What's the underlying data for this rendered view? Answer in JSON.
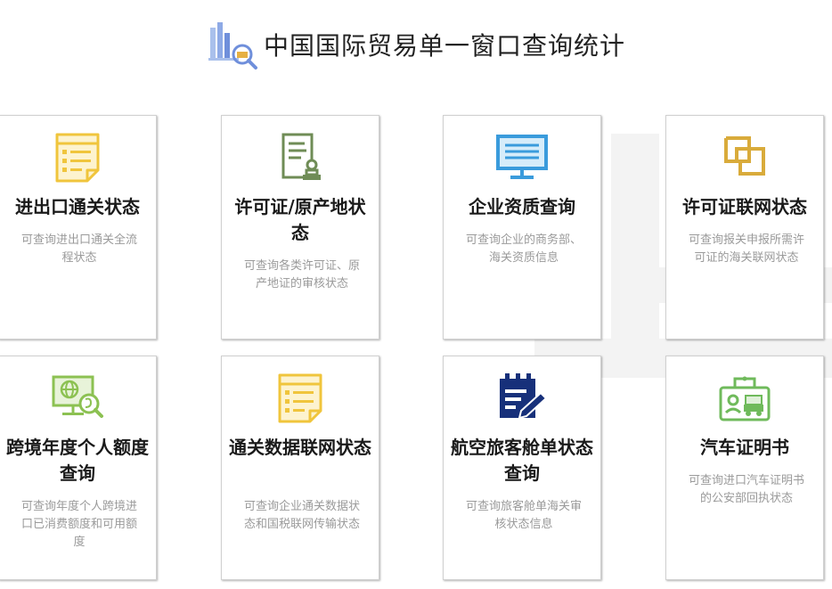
{
  "header": {
    "title": "中国国际贸易单一窗口查询统计"
  },
  "cards": [
    {
      "title": "进出口通关状态",
      "desc": "可查询进出口通关全流程状态"
    },
    {
      "title": "许可证/原产地状态",
      "desc": "可查询各类许可证、原产地证的审核状态"
    },
    {
      "title": "企业资质查询",
      "desc": "可查询企业的商务部、海关资质信息"
    },
    {
      "title": "许可证联网状态",
      "desc": "可查询报关申报所需许可证的海关联网状态"
    },
    {
      "title": "跨境年度个人额度查询",
      "desc": "可查询年度个人跨境进口已消费额度和可用额度"
    },
    {
      "title": "通关数据联网状态",
      "desc": "可查询企业通关数据状态和国税联网传输状态"
    },
    {
      "title": "航空旅客舱单状态查询",
      "desc": "可查询旅客舱单海关审核状态信息"
    },
    {
      "title": "汽车证明书",
      "desc": "可查询进口汽车证明书的公安部回执状态"
    }
  ],
  "colors": {
    "yellow": "#f0c53c",
    "green": "#6f8c56",
    "blue": "#3a9bdc",
    "gold": "#d9ab3b",
    "lime": "#8cc152",
    "navy": "#17307a",
    "title": "#1a1a1a",
    "desc": "#9a9a9a"
  }
}
